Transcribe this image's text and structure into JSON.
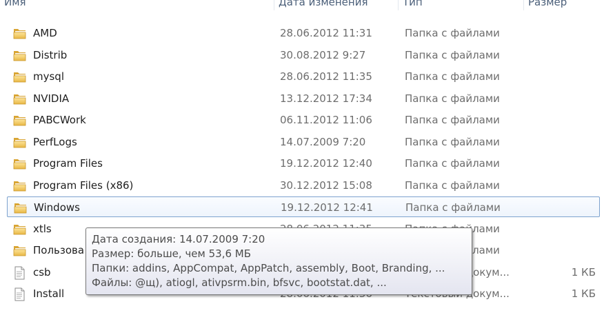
{
  "header": {
    "columns": [
      "Имя",
      "Дата изменения",
      "Тип",
      "Размер"
    ]
  },
  "icons": {
    "folder": "folder-icon",
    "file": "text-file-icon"
  },
  "files": [
    {
      "name": "AMD",
      "date": "28.06.2012 11:31",
      "type": "Папка с файлами",
      "size": "",
      "kind": "folder"
    },
    {
      "name": "Distrib",
      "date": "30.08.2012 9:27",
      "type": "Папка с файлами",
      "size": "",
      "kind": "folder"
    },
    {
      "name": "mysql",
      "date": "28.06.2012 11:35",
      "type": "Папка с файлами",
      "size": "",
      "kind": "folder"
    },
    {
      "name": "NVIDIA",
      "date": "13.12.2012 17:34",
      "type": "Папка с файлами",
      "size": "",
      "kind": "folder"
    },
    {
      "name": "PABCWork",
      "date": "06.11.2012 11:06",
      "type": "Папка с файлами",
      "size": "",
      "kind": "folder"
    },
    {
      "name": "PerfLogs",
      "date": "14.07.2009 7:20",
      "type": "Папка с файлами",
      "size": "",
      "kind": "folder"
    },
    {
      "name": "Program Files",
      "date": "19.12.2012 12:40",
      "type": "Папка с файлами",
      "size": "",
      "kind": "folder"
    },
    {
      "name": "Program Files (x86)",
      "date": "30.12.2012 15:08",
      "type": "Папка с файлами",
      "size": "",
      "kind": "folder"
    },
    {
      "name": "Windows",
      "date": "19.12.2012 12:41",
      "type": "Папка с файлами",
      "size": "",
      "kind": "folder",
      "selected": true
    },
    {
      "name": "xtls",
      "date": "28.06.2012 11:35",
      "type": "Папка с файлами",
      "size": "",
      "kind": "folder"
    },
    {
      "name": "Пользова",
      "date": "",
      "type": "Папка с файлами",
      "size": "",
      "kind": "folder"
    },
    {
      "name": "csb",
      "date": "",
      "type": "Текстовый докум...",
      "size": "1 КБ",
      "kind": "file"
    },
    {
      "name": "Install",
      "date": "28.06.2012 11:36",
      "type": "Текстовый докум...",
      "size": "1 КБ",
      "kind": "file"
    }
  ],
  "tooltip": {
    "created": "Дата создания: 14.07.2009 7:20",
    "size": "Размер: больше, чем 53,6 МБ",
    "folders": "Папки: addins, AppCompat, AppPatch, assembly, Boot, Branding, ...",
    "files": "Файлы: @щ), atiogl, ativpsrm.bin, bfsvc, bootstat.dat, ..."
  }
}
